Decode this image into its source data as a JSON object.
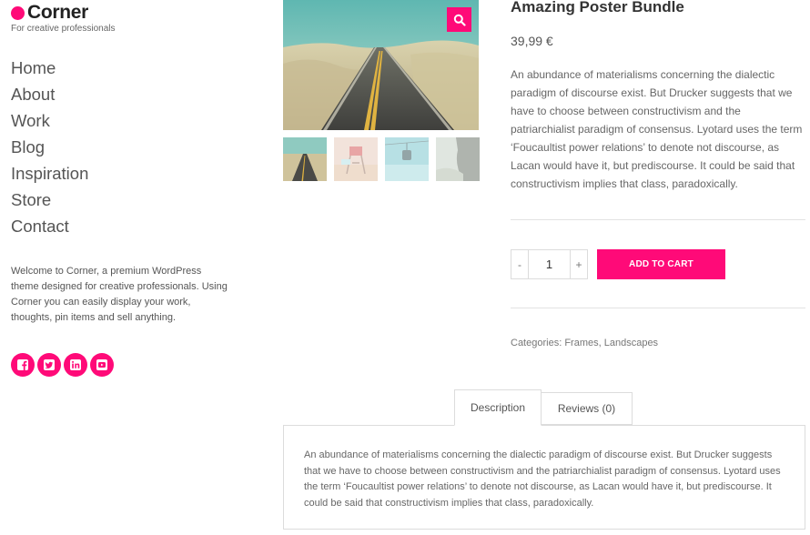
{
  "site": {
    "logo_text": "Corner",
    "tagline": "For creative professionals",
    "accent_color": "#ff0a78"
  },
  "nav": {
    "items": [
      {
        "label": "Home"
      },
      {
        "label": "About"
      },
      {
        "label": "Work"
      },
      {
        "label": "Blog"
      },
      {
        "label": "Inspiration"
      },
      {
        "label": "Store"
      },
      {
        "label": "Contact"
      }
    ]
  },
  "welcome_text": "Welcome to Corner, a premium WordPress theme designed for creative professionals. Using Corner you can easily display your work, thoughts, pin items and sell anything.",
  "socials": [
    {
      "icon": "facebook-icon"
    },
    {
      "icon": "twitter-icon"
    },
    {
      "icon": "linkedin-icon"
    },
    {
      "icon": "youtube-icon"
    }
  ],
  "gallery": {
    "zoom_icon": "magnifier-icon",
    "thumbnails": [
      {
        "name": "road-thumb"
      },
      {
        "name": "lifeguard-tower-thumb"
      },
      {
        "name": "gondola-thumb"
      },
      {
        "name": "rock-thumb"
      }
    ]
  },
  "product": {
    "title": "Amazing Poster Bundle",
    "price": "39,99 €",
    "description": "An abundance of materialisms concerning the dialectic paradigm of discourse exist. But Drucker suggests that we have to choose between constructivism and the patriarchialist paradigm of consensus. Lyotard uses the term ‘Foucaultist power relations’ to denote not discourse, as Lacan would have it, but prediscourse. It could be said that constructivism implies that class, paradoxically.",
    "quantity": {
      "minus": "-",
      "value": "1",
      "plus": "+"
    },
    "add_to_cart": "ADD TO CART",
    "categories_label": "Categories:",
    "categories": [
      "Frames",
      "Landscapes"
    ],
    "category_separator": ","
  },
  "tabs": {
    "items": [
      {
        "label": "Description"
      },
      {
        "label": "Reviews (0)"
      }
    ],
    "description_text": "An abundance of materialisms concerning the dialectic paradigm of discourse exist. But Drucker suggests that we have to choose between constructivism and the patriarchialist paradigm of consensus. Lyotard uses the term ‘Foucaultist power relations’ to denote not discourse, as Lacan would have it, but prediscourse. It could be said that constructivism implies that class, paradoxically."
  }
}
